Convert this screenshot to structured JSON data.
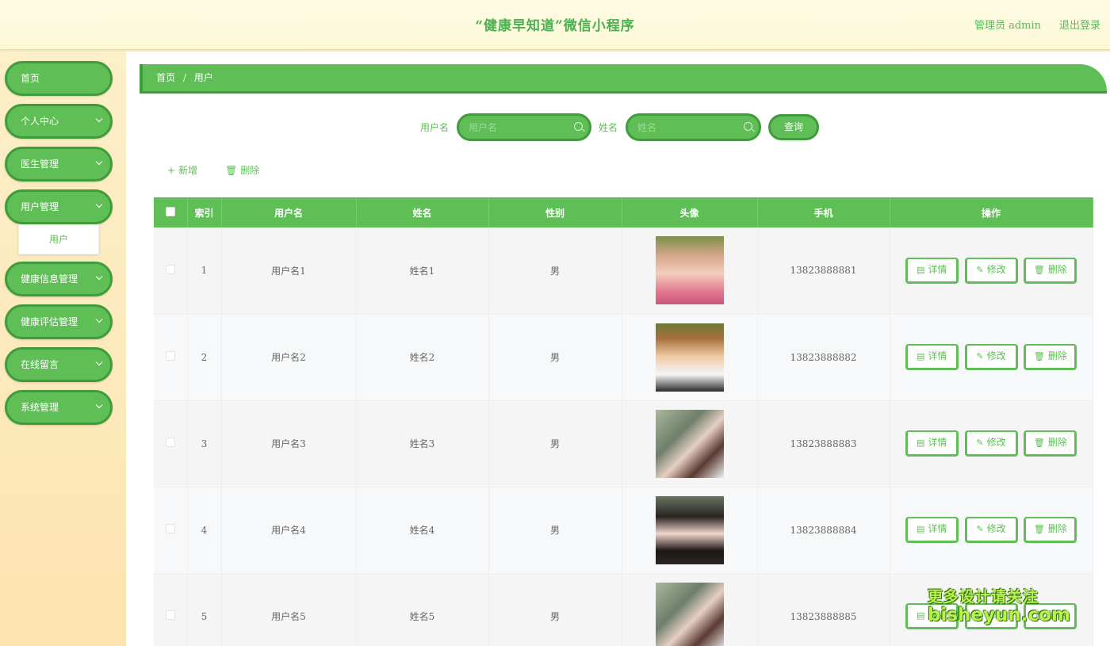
{
  "header": {
    "title": "“健康早知道”微信小程序",
    "admin": "管理员 admin",
    "logout": "退出登录"
  },
  "sidebar": {
    "items": [
      {
        "label": "首页"
      },
      {
        "label": "个人中心"
      },
      {
        "label": "医生管理"
      },
      {
        "label": "用户管理"
      },
      {
        "label": "健康信息管理"
      },
      {
        "label": "健康评估管理"
      },
      {
        "label": "在线留言"
      },
      {
        "label": "系统管理"
      }
    ],
    "submenu": {
      "label": "用户"
    }
  },
  "breadcrumb": {
    "home": "首页",
    "separator": "/",
    "current": "用户"
  },
  "search": {
    "username_label": "用户名",
    "username_placeholder": "用户名",
    "name_label": "姓名",
    "name_placeholder": "姓名",
    "query_button": "查询"
  },
  "toolbar": {
    "add": "新增",
    "delete": "删除"
  },
  "table": {
    "headers": [
      "索引",
      "用户名",
      "姓名",
      "性别",
      "头像",
      "手机",
      "操作"
    ],
    "actions": {
      "detail": "详情",
      "edit": "修改",
      "delete": "删除"
    },
    "rows": [
      {
        "index": "1",
        "username": "用户名1",
        "name": "姓名1",
        "gender": "男",
        "phone": "13823888881"
      },
      {
        "index": "2",
        "username": "用户名2",
        "name": "姓名2",
        "gender": "男",
        "phone": "13823888882"
      },
      {
        "index": "3",
        "username": "用户名3",
        "name": "姓名3",
        "gender": "男",
        "phone": "13823888883"
      },
      {
        "index": "4",
        "username": "用户名4",
        "name": "姓名4",
        "gender": "男",
        "phone": "13823888884"
      },
      {
        "index": "5",
        "username": "用户名5",
        "name": "姓名5",
        "gender": "男",
        "phone": "13823888885"
      }
    ]
  },
  "watermark": {
    "line1": "更多设计请关注",
    "line2": "bisheyun.com"
  },
  "colors": {
    "primary": "#5fbf56",
    "primary_dark": "#3f9c3b",
    "sidebar_bg": "#fdefc8",
    "header_bg": "#fdfbe4"
  }
}
